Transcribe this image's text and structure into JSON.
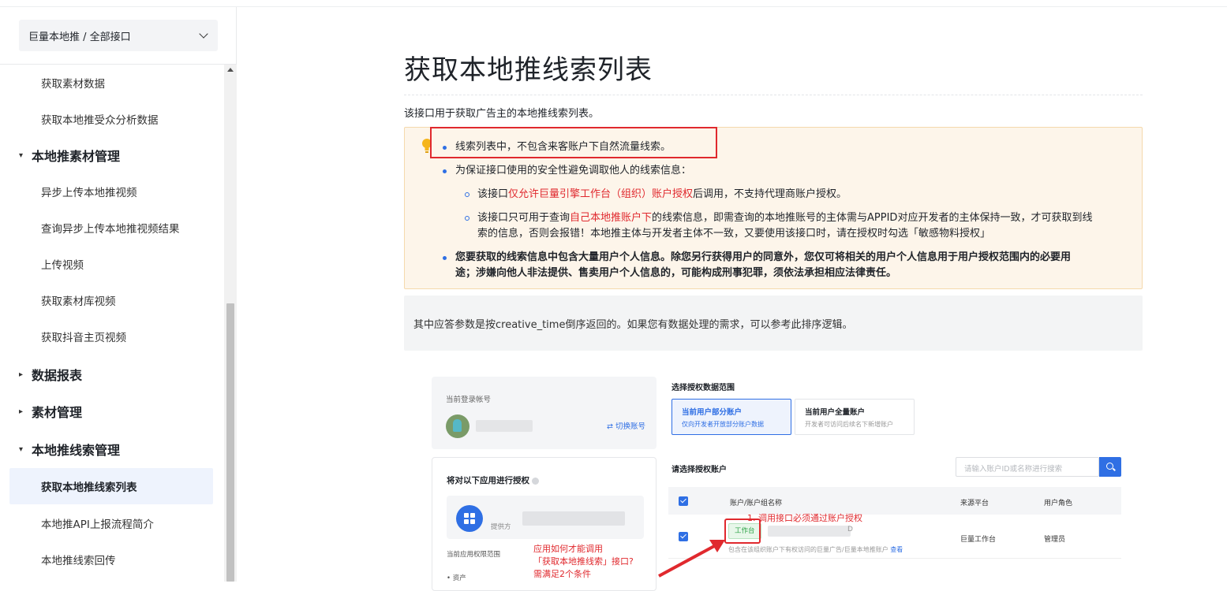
{
  "sidebar": {
    "selector_label": "巨量本地推 / 全部接口",
    "items": [
      {
        "type": "item",
        "label": "获取素材数据"
      },
      {
        "type": "item",
        "label": "获取本地推受众分析数据"
      },
      {
        "type": "group",
        "label": "本地推素材管理",
        "expanded": true
      },
      {
        "type": "item",
        "label": "异步上传本地推视频"
      },
      {
        "type": "item",
        "label": "查询异步上传本地推视频结果"
      },
      {
        "type": "item",
        "label": "上传视频"
      },
      {
        "type": "item",
        "label": "获取素材库视频"
      },
      {
        "type": "item",
        "label": "获取抖音主页视频"
      },
      {
        "type": "group",
        "label": "数据报表",
        "expanded": false
      },
      {
        "type": "group",
        "label": "素材管理",
        "expanded": false
      },
      {
        "type": "group",
        "label": "本地推线索管理",
        "expanded": true
      },
      {
        "type": "item",
        "label": "获取本地推线索列表",
        "active": true
      },
      {
        "type": "item",
        "label": "本地推API上报流程简介"
      },
      {
        "type": "item",
        "label": "本地推线索回传"
      }
    ]
  },
  "main": {
    "title": "获取本地推线索列表",
    "intro": "该接口用于获取广告主的本地推线索列表。",
    "notice": {
      "b1": "线索列表中，不包含来客账户下自然流量线索。",
      "b2": "为保证接口使用的安全性避免调取他人的线索信息：",
      "s1_pre": "该接口",
      "s1_red": "仅允许巨量引擎工作台（组织）账户授权",
      "s1_post": "后调用，不支持代理商账户授权。",
      "s2_pre": "该接口只可用于查询",
      "s2_red": "自己本地推账户下",
      "s2_post_1": "的线索信息，即需查询的本地推账号的主体需与APPID对应开发者的主体保持一致，才可获取到线",
      "s2_post_2": "索的信息，否则会报错！本地推主体与开发者主体不一致，又要使用该接口时，请在授权时勾选「敏感物料授权」",
      "b3_1": "您要获取的线索信息中包含大量用户个人信息。除您另行获得用户的同意外，您仅可将相关的用户个人信息用于用户授权范围内的必要用",
      "b3_2": "途；涉嫌向他人非法提供、售卖用户个人信息的，可能构成刑事犯罪，须依法承担相应法律责任。"
    },
    "gray_note": "其中应答参数是按creative_time倒序返回的。如果您有数据处理的需求，可以参考此排序逻辑。"
  },
  "shot": {
    "login_label": "当前登录帐号",
    "switch_label": "⇄ 切换账号",
    "auth_title": "将对以下应用进行授权",
    "provider": "提供方",
    "scope_label": "当前应用权限范围",
    "asset_label": "• 资产",
    "annot_left_1": "应用如何才能调用",
    "annot_left_2": "「获取本地推线索」接口?",
    "annot_left_3": "需满足2个条件",
    "scope_title": "选择授权数据范围",
    "opt1_title": "当前用户部分账户",
    "opt1_desc": "仅向开发者开放部分账户数据",
    "opt2_title": "当前用户全量账户",
    "opt2_desc": "开发者可访问后续名下新增账户",
    "select_title": "请选择授权账户",
    "search_placeholder": "请输入账户ID或名称进行搜索",
    "col_account": "账户/账户组名称",
    "col_source": "来源平台",
    "col_role": "用户角色",
    "row_tag": "工作台",
    "row_d": "D",
    "row_desc": "包含在该组织账户下有权访问的巨量广告/巨量本地推账户",
    "row_look": "查看",
    "row_source": "巨量工作台",
    "row_role": "管理员",
    "annot_right": "1. 调用接口必须通过账户授权"
  },
  "colors": {
    "accent": "#2f6fe4",
    "annotation_red": "#e0292e",
    "notice_bg": "#fdf5ea"
  }
}
